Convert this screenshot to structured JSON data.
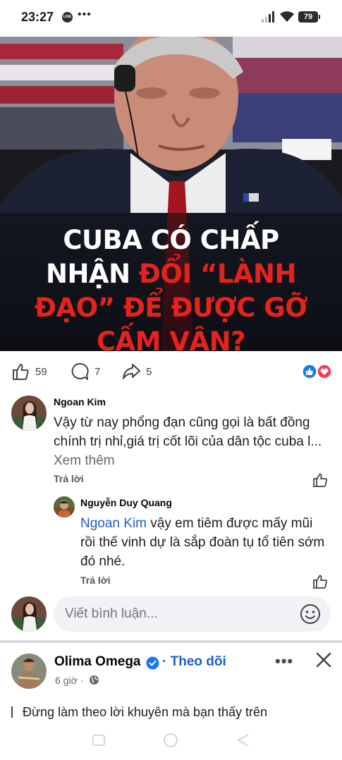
{
  "status_bar": {
    "time": "23:27",
    "app_icon": "LINE",
    "battery": "79"
  },
  "post": {
    "image_headline": {
      "line1": "CUBA CÓ CHẤP",
      "line2_white": "NHẬN ",
      "line2_red": "ĐỔI “LÀNH",
      "line3": "ĐẠO” ĐỂ ĐƯỢC GỠ",
      "line4": "CẤM VẬN?"
    },
    "reactions": {
      "likes": "59",
      "comments": "7",
      "shares": "5"
    }
  },
  "comments": [
    {
      "author": "Ngoan Kim",
      "text": "Vậy từ nay phổng đạn cũng gọi là bất đồng chính trị nhỉ,giá trị cốt lõi của dân tộc cuba l...",
      "more_label": " Xem thêm",
      "reply_label": "Trả lời"
    },
    {
      "author": "Nguyễn Duy Quang",
      "mention": "Ngoan Kim",
      "text": " vậy em tiêm được mấy mũi rồi thế vinh dự là sắp đoàn tụ tổ tiên sớm đó nhé.",
      "reply_label": "Trả lời"
    }
  ],
  "composer": {
    "placeholder": "Viết bình luận..."
  },
  "next_post": {
    "author": "Olima Omega",
    "follow_label": "Theo dõi",
    "separator": "·",
    "time": "6 giờ ·",
    "text": "Đừng làm theo lời khuyên mà bạn thấy trên"
  },
  "colors": {
    "link": "#1b5fc9",
    "headline_red": "#e4231c",
    "like_blue": "#1877f2",
    "love_red": "#f33e58"
  },
  "icons": [
    "signal-icon",
    "wifi-icon",
    "like-icon",
    "comment-icon",
    "share-icon",
    "emoji-icon",
    "verified-icon",
    "globe-icon",
    "more-icon",
    "close-icon"
  ]
}
